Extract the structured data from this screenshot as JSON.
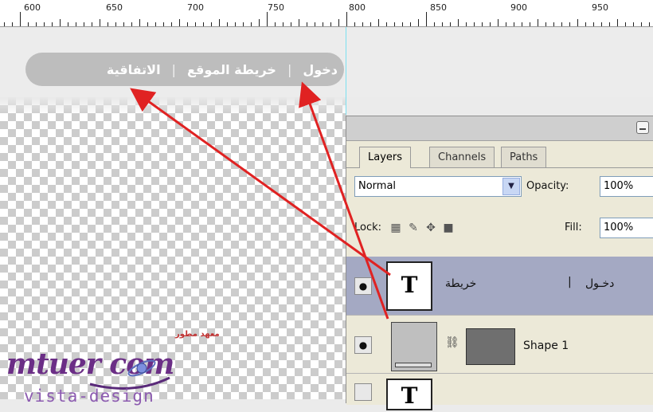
{
  "ruler": {
    "labels": [
      "600",
      "650",
      "700",
      "750",
      "800",
      "850",
      "900",
      "950"
    ]
  },
  "canvas": {
    "menu": {
      "items": [
        "دخول",
        "خريطة الموقع",
        "الاتفاقية"
      ],
      "separator": "|"
    },
    "logo": {
      "main": "mtuer com",
      "subtitle": "معهد مطور",
      "tagline": "vista-design"
    }
  },
  "panel": {
    "tabs": [
      "Layers",
      "Channels",
      "Paths"
    ],
    "blend_mode": "Normal",
    "opacity_label": "Opacity:",
    "opacity_value": "100%",
    "lock_label": "Lock:",
    "fill_label": "Fill:",
    "fill_value": "100%",
    "layers": [
      {
        "name": "خريطة",
        "name2": "دخـول",
        "thumb": "T",
        "icon": "eye-icon"
      },
      {
        "name": "Shape 1",
        "icon": "eye-icon"
      },
      {
        "thumb": "T"
      }
    ]
  },
  "colors": {
    "arrow": "#e02222",
    "layer_selected": "#a4a9c3",
    "menu_pill": "#bdbdbd"
  }
}
